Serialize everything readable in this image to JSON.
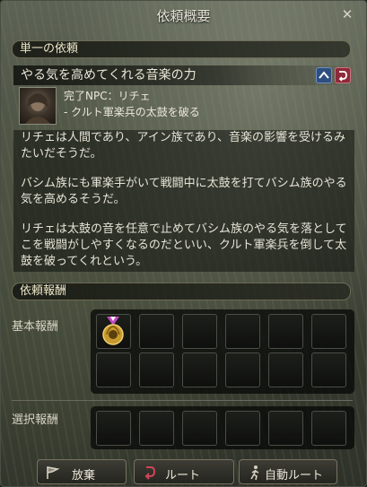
{
  "window": {
    "title": "依頼概要",
    "close_glyph": "✕"
  },
  "section": {
    "label": "単一の依頼"
  },
  "quest": {
    "title": "やる気を高めてくれる音楽の力",
    "npc_line": "完了NPC：リチェ",
    "objective": "- クルト軍楽兵の太鼓を破る",
    "share_icon": "up-arrow-icon",
    "route_icon": "route-icon"
  },
  "description": {
    "paragraphs": [
      "リチェは人間であり、アイン族であり、音楽の影響を受けるみたいだそうだ。",
      "バシム族にも軍楽手がいて戦闘中に太鼓を打てバシム族のやる気を高めるそうだ。",
      "リチェは太鼓の音を任意で止めてバシム族のやる気を落としてこを戦闘がしやすくなるのだといい、クルト軍楽兵を倒して太鼓を破ってくれという。"
    ]
  },
  "rewards": {
    "header": "依頼報酬",
    "basic_label": "基本報酬",
    "choice_label": "選択報酬",
    "basic_items": [
      "medal-icon",
      "",
      "",
      "",
      "",
      "",
      "",
      "",
      "",
      "",
      "",
      ""
    ],
    "choice_items": [
      "",
      "",
      "",
      "",
      "",
      ""
    ]
  },
  "buttons": {
    "abandon": "放棄",
    "route": "ルート",
    "auto_route": "自動ルート"
  },
  "colors": {
    "accent_blue": "#3f6fb5",
    "accent_red": "#b5394a",
    "text": "#e6e1d2"
  }
}
